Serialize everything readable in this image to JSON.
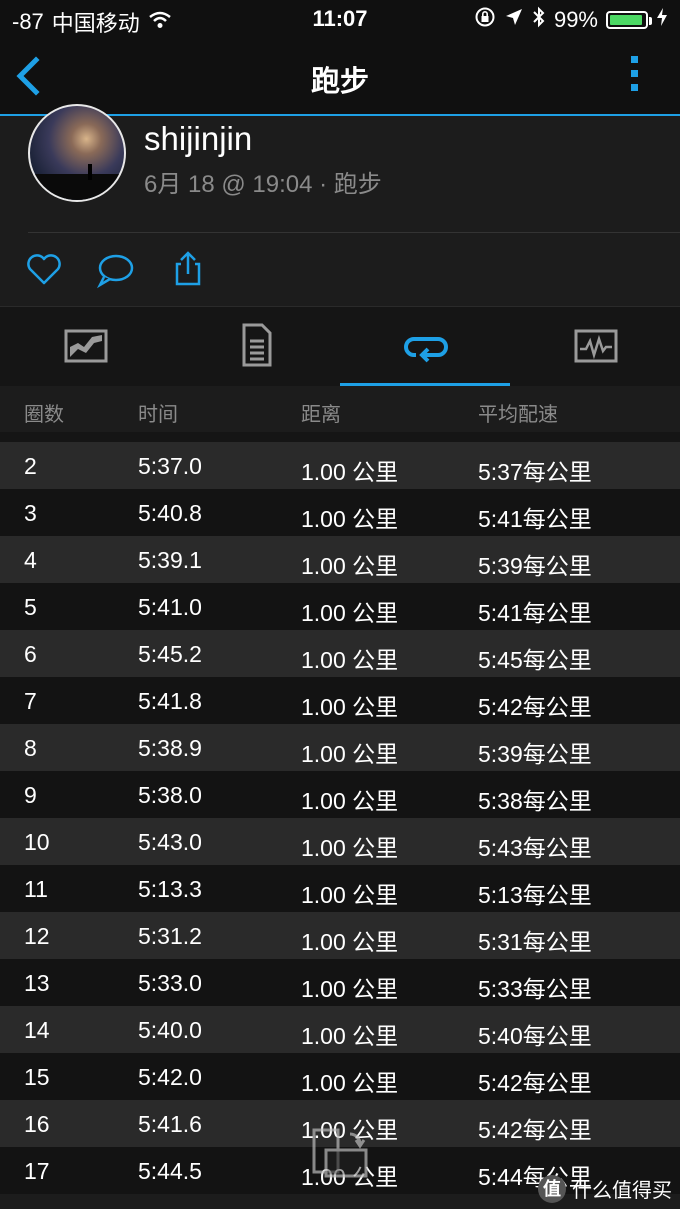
{
  "status_bar": {
    "signal": "-87",
    "carrier": "中国移动",
    "time": "11:07",
    "battery": "99%"
  },
  "nav": {
    "title": "跑步"
  },
  "profile": {
    "name": "shijinjin",
    "meta": "6月 18 @ 19:04 · 跑步"
  },
  "tabs": [
    {
      "name": "overview",
      "icon": "chart-icon"
    },
    {
      "name": "details",
      "icon": "document-icon"
    },
    {
      "name": "laps",
      "icon": "loop-icon",
      "active": true
    },
    {
      "name": "graphs",
      "icon": "pulse-icon"
    }
  ],
  "table": {
    "headers": [
      "圈数",
      "时间",
      "距离",
      "平均配速"
    ],
    "rows": [
      [
        "2",
        "5:37.0",
        "1.00 公里",
        "5:37每公里"
      ],
      [
        "3",
        "5:40.8",
        "1.00 公里",
        "5:41每公里"
      ],
      [
        "4",
        "5:39.1",
        "1.00 公里",
        "5:39每公里"
      ],
      [
        "5",
        "5:41.0",
        "1.00 公里",
        "5:41每公里"
      ],
      [
        "6",
        "5:45.2",
        "1.00 公里",
        "5:45每公里"
      ],
      [
        "7",
        "5:41.8",
        "1.00 公里",
        "5:42每公里"
      ],
      [
        "8",
        "5:38.9",
        "1.00 公里",
        "5:39每公里"
      ],
      [
        "9",
        "5:38.0",
        "1.00 公里",
        "5:38每公里"
      ],
      [
        "10",
        "5:43.0",
        "1.00 公里",
        "5:43每公里"
      ],
      [
        "11",
        "5:13.3",
        "1.00 公里",
        "5:13每公里"
      ],
      [
        "12",
        "5:31.2",
        "1.00 公里",
        "5:31每公里"
      ],
      [
        "13",
        "5:33.0",
        "1.00 公里",
        "5:33每公里"
      ],
      [
        "14",
        "5:40.0",
        "1.00 公里",
        "5:40每公里"
      ],
      [
        "15",
        "5:42.0",
        "1.00 公里",
        "5:42每公里"
      ],
      [
        "16",
        "5:41.6",
        "1.00 公里",
        "5:42每公里"
      ],
      [
        "17",
        "5:44.5",
        "1.00 公里",
        "5:44每公里"
      ]
    ]
  },
  "watermark": {
    "badge": "值",
    "text": "什么值得买"
  },
  "colors": {
    "accent": "#1ea0e6",
    "background": "#1c1c1c",
    "battery": "#4cd964"
  }
}
